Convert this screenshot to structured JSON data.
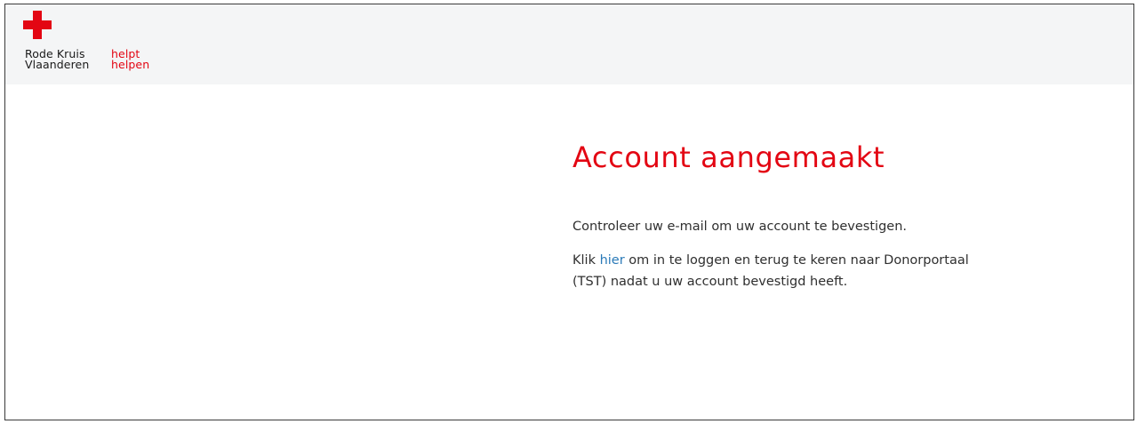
{
  "header": {
    "logo": {
      "icon": "red-cross-icon",
      "org_line1": "Rode Kruis",
      "org_line2": "Vlaanderen",
      "slogan_line1": "helpt",
      "slogan_line2": "helpen"
    }
  },
  "main": {
    "title": "Account aangemaakt",
    "message": "Controleer uw e-mail om uw account te bevestigen.",
    "login_prefix": "Klik ",
    "login_link": "hier",
    "login_suffix_line1": " om in te loggen en terug te keren naar Donorportaal",
    "login_suffix_line2": "(TST) nadat u uw account bevestigd heeft."
  },
  "colors": {
    "brand_red": "#e30613",
    "link_blue": "#2a7ab8",
    "header_bg": "#f4f5f6",
    "text": "#2f2f2f"
  }
}
